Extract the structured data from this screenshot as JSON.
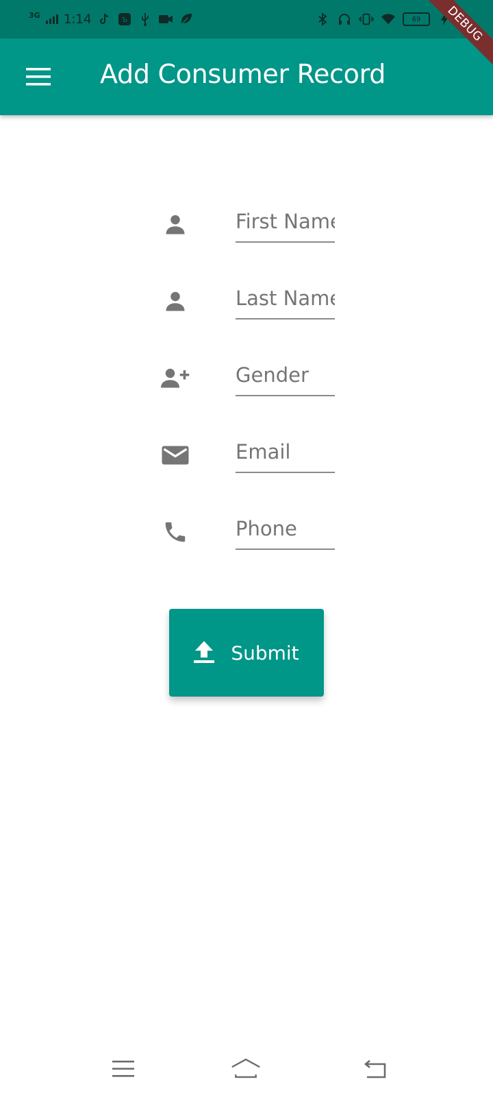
{
  "status_bar": {
    "network_type": "3G",
    "time": "1:14",
    "battery_level": "69",
    "icons_left": [
      "signal-icon",
      "tiktok-icon",
      "app-icon",
      "usb-icon",
      "video-icon",
      "leaf-icon"
    ],
    "icons_right": [
      "bluetooth-icon",
      "headphones-icon",
      "vibrate-icon",
      "wifi-icon",
      "battery-icon",
      "charging-icon"
    ]
  },
  "debug_banner": "DEBUG",
  "app_bar": {
    "title": "Add Consumer Record",
    "menu_icon": "menu-icon",
    "background": "#009688",
    "status_background": "#00796b"
  },
  "form": {
    "fields": [
      {
        "name": "first-name",
        "placeholder": "First Name",
        "icon": "person-icon"
      },
      {
        "name": "last-name",
        "placeholder": "Last Name",
        "icon": "person-icon"
      },
      {
        "name": "gender",
        "placeholder": "Gender",
        "icon": "person-add-icon"
      },
      {
        "name": "email",
        "placeholder": "Email",
        "icon": "email-icon"
      },
      {
        "name": "phone",
        "placeholder": "Phone",
        "icon": "phone-icon"
      }
    ],
    "submit": {
      "label": "Submit",
      "icon": "upload-icon"
    }
  },
  "nav_bar": {
    "buttons": [
      "menu-nav-icon",
      "home-nav-icon",
      "back-nav-icon"
    ]
  }
}
